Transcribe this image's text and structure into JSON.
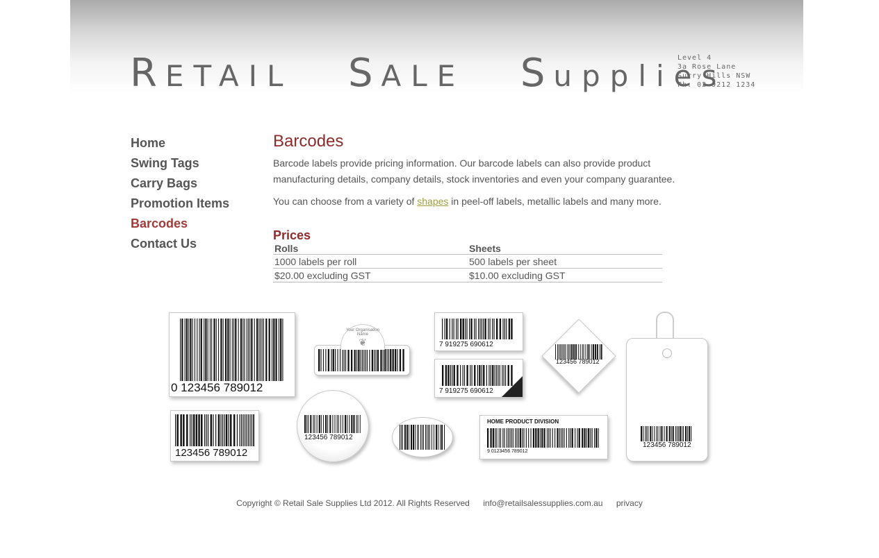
{
  "header": {
    "logo_word1_first": "R",
    "logo_word1_rest": "ETAIL",
    "logo_word2_first": "S",
    "logo_word2_rest": "ALE",
    "logo_word3_first": "S",
    "logo_word3_rest": "upplies",
    "address": [
      "Level 4",
      "3a Rose Lane",
      "Surry Hills NSW",
      "Ph: 02 9212 1234"
    ]
  },
  "nav": {
    "items": [
      {
        "label": "Home"
      },
      {
        "label": "Swing Tags"
      },
      {
        "label": "Carry Bags"
      },
      {
        "label": "Promotion Items"
      },
      {
        "label": "Barcodes",
        "active": true
      },
      {
        "label": "Contact Us"
      }
    ]
  },
  "main": {
    "title": "Barcodes",
    "para1": "Barcode labels provide pricing information. Our barcode labels can also provide product manufacturing details, company details, stock inventories and even your company guarantee.",
    "para2_before": "You can choose from a variety of ",
    "para2_link": "shapes",
    "para2_after": " in peel-off labels, metallic labels and many more.",
    "prices_title": "Prices",
    "table": {
      "headers": [
        "Rolls",
        "Sheets"
      ],
      "rows": [
        [
          "1000 labels per roll",
          "500 labels per sheet"
        ],
        [
          "$20.00 excluding GST",
          "$10.00 excluding GST"
        ]
      ]
    }
  },
  "gallery": {
    "big_label_number": "0 123456 789012",
    "small_rect_number": "123456 789012",
    "circle_number": "123456 789012",
    "diamond_number": "123456 789012",
    "tag_number": "123456 789012",
    "dept_title": "HOME PRODUCT DIVISION",
    "dept_number": "9 0123456 789012",
    "ean1_number": "7  919275  690612",
    "ean2_number": "7  919275  690612",
    "org_text": "Your Organisation Name"
  },
  "footer": {
    "copyright": "Copyright © Retail Sale Supplies Ltd 2012. All Rights Reserved",
    "email": "info@retailsalessupplies.com.au",
    "privacy": "privacy"
  }
}
